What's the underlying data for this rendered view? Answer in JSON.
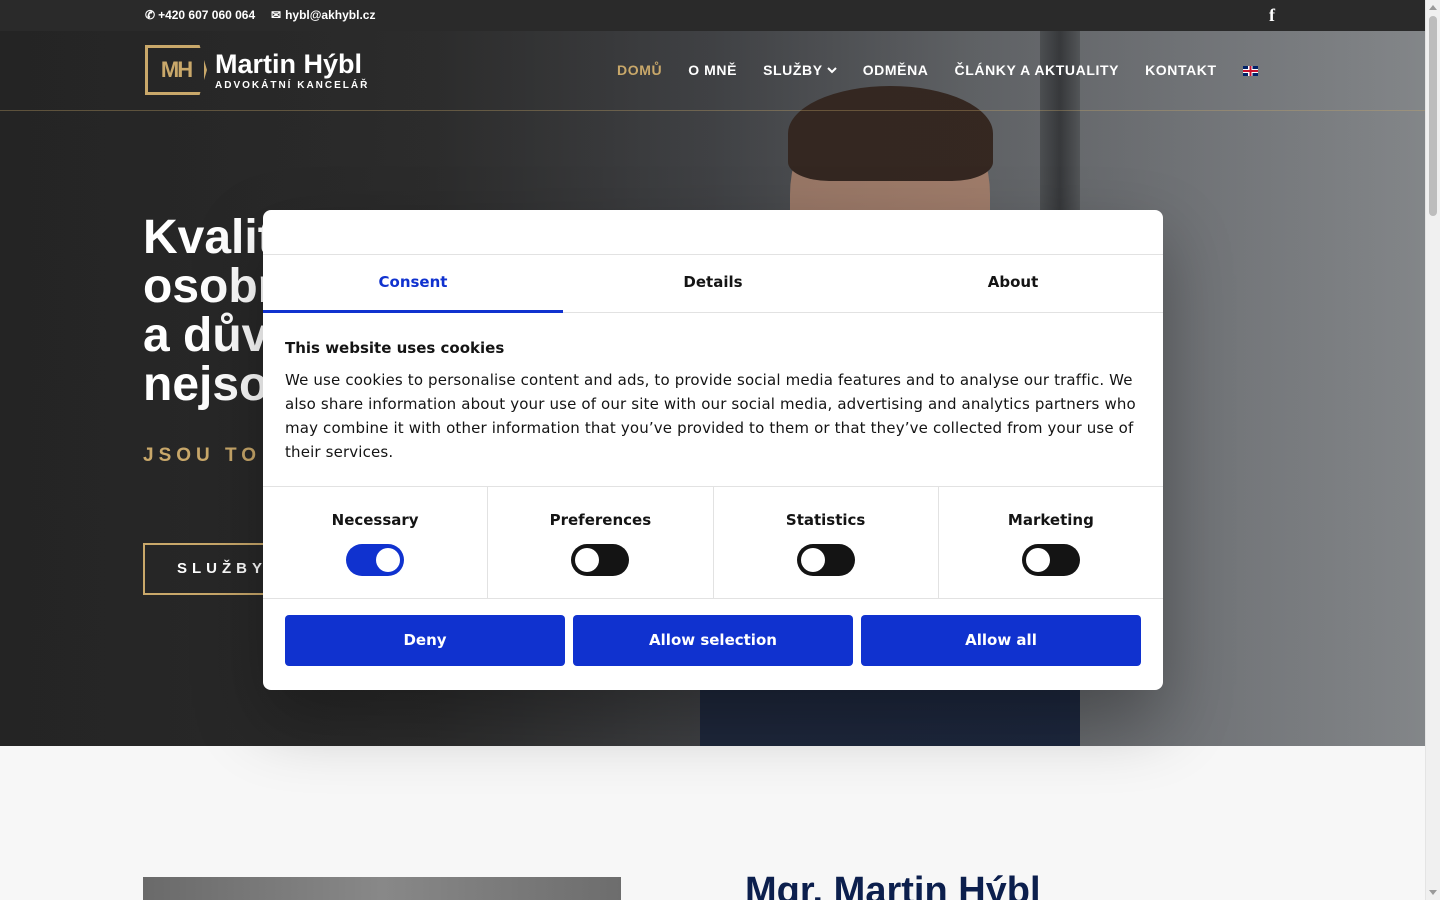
{
  "topbar": {
    "phone": "+420 607 060 064",
    "email": "hybl@akhybl.cz",
    "facebook_glyph": "f"
  },
  "logo": {
    "mark": "MH",
    "name": "Martin Hýbl",
    "subtitle": "ADVOKÁTNÍ KANCELÁŘ"
  },
  "nav": {
    "items": [
      "DOMŮ",
      "O MNĚ",
      "SLUŽBY",
      "ODMĚNA",
      "ČLÁNKY A AKTUALITY",
      "KONTAKT"
    ],
    "active_index": 0,
    "services_has_dropdown": true,
    "language_flag": "uk-flag-icon"
  },
  "hero": {
    "title_lines": [
      "Kvalit",
      "osobn",
      "a důvě",
      "nejsou"
    ],
    "subtitle": "JSOU TO H",
    "button_label": "SLUŽBY"
  },
  "lower": {
    "title": "Mgr. Martin Hýbl"
  },
  "cookie_dialog": {
    "tabs": [
      "Consent",
      "Details",
      "About"
    ],
    "active_tab": 0,
    "heading": "This website uses cookies",
    "text": "We use cookies to personalise content and ads, to provide social media features and to analyse our traffic. We also share information about your use of our site with our social media, advertising and analytics partners who may combine it with other information that you’ve provided to them or that they’ve collected from your use of their services.",
    "categories": [
      {
        "label": "Necessary",
        "enabled": true
      },
      {
        "label": "Preferences",
        "enabled": false
      },
      {
        "label": "Statistics",
        "enabled": false
      },
      {
        "label": "Marketing",
        "enabled": false
      }
    ],
    "buttons": {
      "deny": "Deny",
      "allow_selection": "Allow selection",
      "allow_all": "Allow all"
    }
  },
  "colors": {
    "accent_gold": "#c9a86a",
    "dialog_blue": "#1032cf",
    "dark_navy": "#0c1f4d"
  }
}
